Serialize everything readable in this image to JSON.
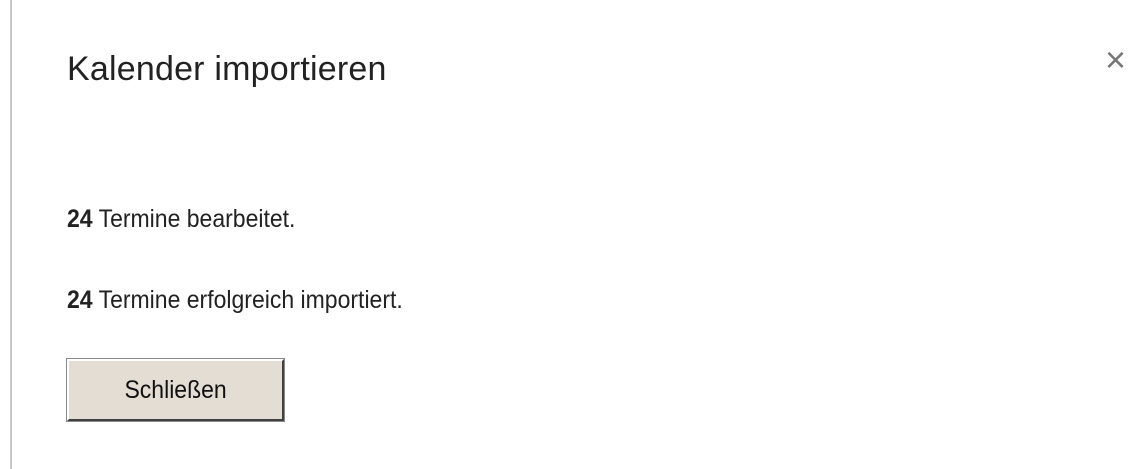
{
  "dialog": {
    "title": "Kalender importieren",
    "close_icon": "×",
    "icons": {
      "close": "close-icon"
    }
  },
  "messages": [
    {
      "count": "24",
      "text": "Termine bearbeitet."
    },
    {
      "count": "24",
      "text": "Termine erfolgreich importiert."
    }
  ],
  "button": {
    "close_label": "Schließen"
  },
  "colors": {
    "background": "#ffffff",
    "text": "#222222",
    "button_face": "#e3ddd4",
    "close_icon": "#777777"
  }
}
